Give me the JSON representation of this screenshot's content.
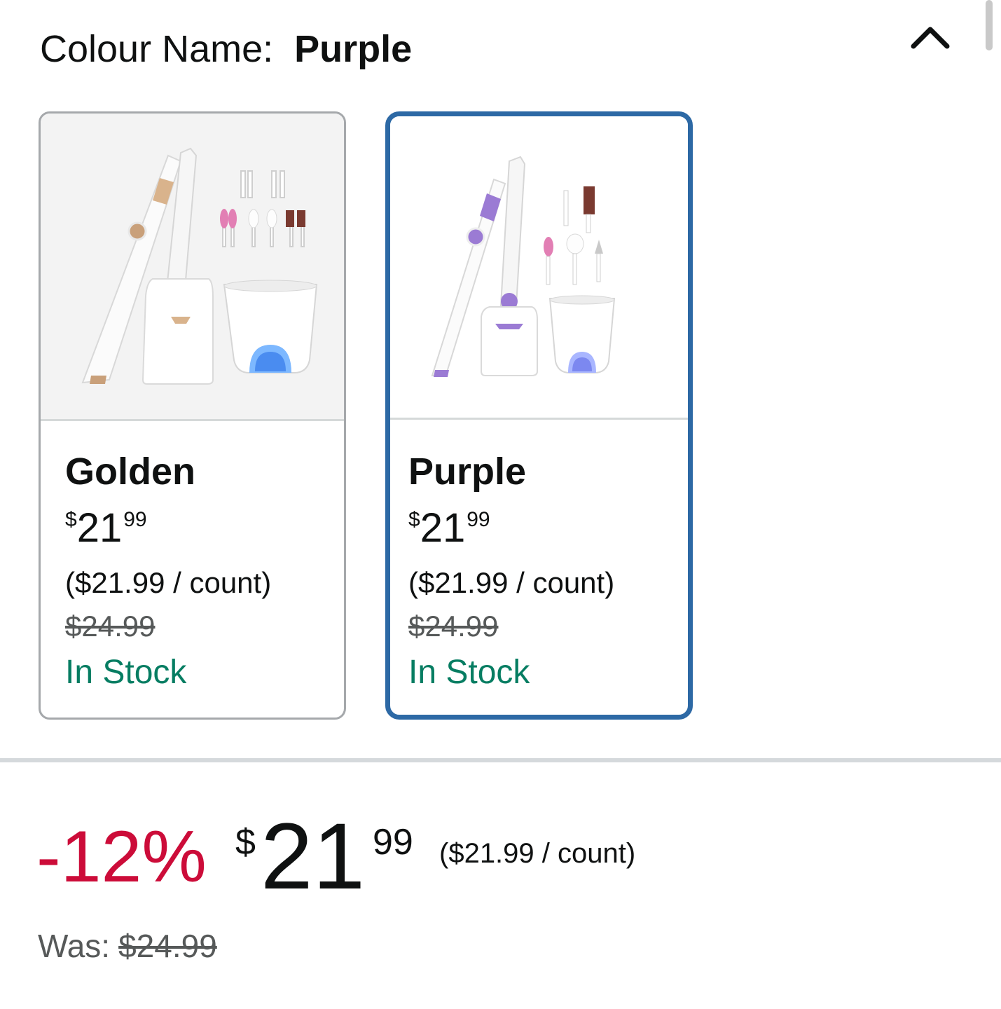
{
  "header": {
    "label": "Colour Name:",
    "selected_value": "Purple"
  },
  "colors": {
    "selected_border": "#2d69a5",
    "stock_green": "#067d62",
    "discount_red": "#cc0c39",
    "strike_gray": "#565959"
  },
  "options": [
    {
      "name": "Golden",
      "price_symbol": "$",
      "price_whole": "21",
      "price_fraction": "99",
      "unit_price": "($21.99 / count)",
      "original_price": "$24.99",
      "availability": "In Stock",
      "selected": false
    },
    {
      "name": "Purple",
      "price_symbol": "$",
      "price_whole": "21",
      "price_fraction": "99",
      "unit_price": "($21.99 / count)",
      "original_price": "$24.99",
      "availability": "In Stock",
      "selected": true
    }
  ],
  "pricing": {
    "discount": "-12%",
    "symbol": "$",
    "whole": "21",
    "fraction": "99",
    "unit_price": "($21.99 / count)",
    "was_label": "Was:",
    "was_price": "$24.99"
  },
  "icons": {
    "collapse": "chevron-up-icon"
  }
}
